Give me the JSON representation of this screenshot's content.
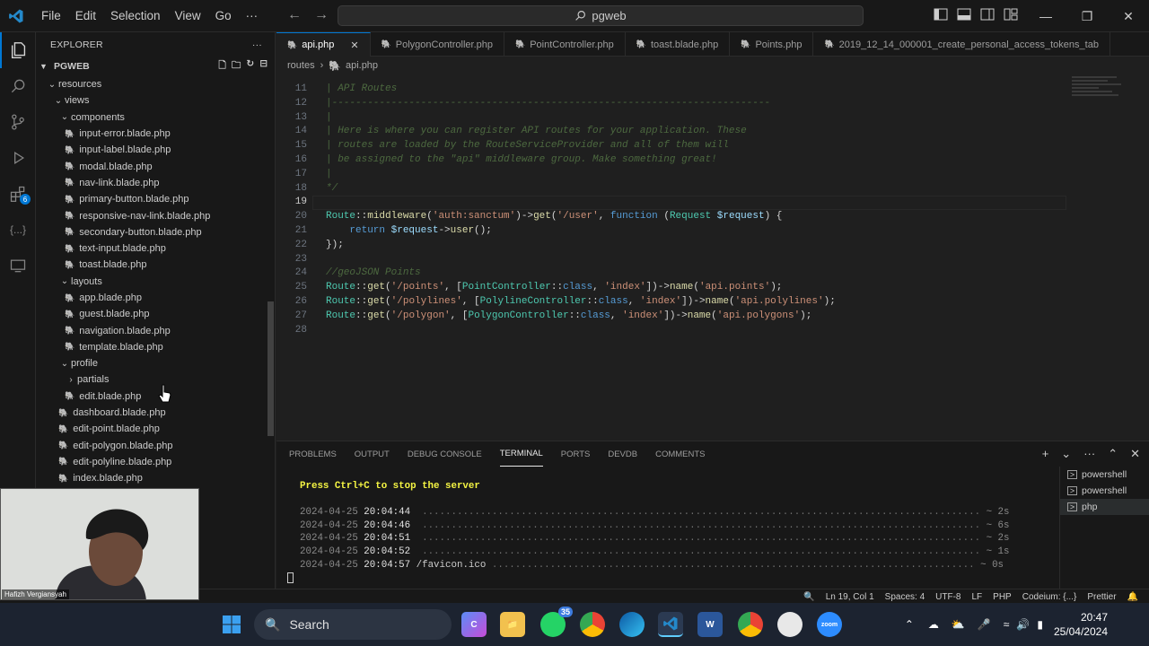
{
  "titlebar": {
    "menu": [
      "File",
      "Edit",
      "Selection",
      "View",
      "Go",
      "···"
    ],
    "search": "pgweb"
  },
  "explorer": {
    "header": "EXPLORER",
    "root": "PGWEB",
    "tree": [
      {
        "label": "resources",
        "type": "folder",
        "indent": 1,
        "open": true
      },
      {
        "label": "views",
        "type": "folder",
        "indent": 2,
        "open": true
      },
      {
        "label": "components",
        "type": "folder",
        "indent": 3,
        "open": true
      },
      {
        "label": "input-error.blade.php",
        "type": "file",
        "indent": 4
      },
      {
        "label": "input-label.blade.php",
        "type": "file",
        "indent": 4
      },
      {
        "label": "modal.blade.php",
        "type": "file",
        "indent": 4
      },
      {
        "label": "nav-link.blade.php",
        "type": "file",
        "indent": 4
      },
      {
        "label": "primary-button.blade.php",
        "type": "file",
        "indent": 4
      },
      {
        "label": "responsive-nav-link.blade.php",
        "type": "file",
        "indent": 4
      },
      {
        "label": "secondary-button.blade.php",
        "type": "file",
        "indent": 4
      },
      {
        "label": "text-input.blade.php",
        "type": "file",
        "indent": 4
      },
      {
        "label": "toast.blade.php",
        "type": "file",
        "indent": 4
      },
      {
        "label": "layouts",
        "type": "folder",
        "indent": 3,
        "open": true
      },
      {
        "label": "app.blade.php",
        "type": "file",
        "indent": 4
      },
      {
        "label": "guest.blade.php",
        "type": "file",
        "indent": 4
      },
      {
        "label": "navigation.blade.php",
        "type": "file",
        "indent": 4
      },
      {
        "label": "template.blade.php",
        "type": "file",
        "indent": 4
      },
      {
        "label": "profile",
        "type": "folder",
        "indent": 3,
        "open": true
      },
      {
        "label": "partials",
        "type": "folder",
        "indent": 4,
        "open": false
      },
      {
        "label": "edit.blade.php",
        "type": "file",
        "indent": 4
      },
      {
        "label": "dashboard.blade.php",
        "type": "file",
        "indent": 3
      },
      {
        "label": "edit-point.blade.php",
        "type": "file",
        "indent": 3
      },
      {
        "label": "edit-polygon.blade.php",
        "type": "file",
        "indent": 3
      },
      {
        "label": "edit-polyline.blade.php",
        "type": "file",
        "indent": 3
      },
      {
        "label": "index.blade.php",
        "type": "file",
        "indent": 3
      }
    ]
  },
  "tabs": [
    "api.php",
    "PolygonController.php",
    "PointController.php",
    "toast.blade.php",
    "Points.php",
    "2019_12_14_000001_create_personal_access_tokens_tab"
  ],
  "breadcrumb": [
    "routes",
    "api.php"
  ],
  "editor": {
    "lines": [
      {
        "n": "11",
        "code": "| API Routes",
        "c": "comment"
      },
      {
        "n": "12",
        "code": "|--------------------------------------------------------------------------",
        "c": "comment"
      },
      {
        "n": "13",
        "code": "|",
        "c": "comment"
      },
      {
        "n": "14",
        "code": "| Here is where you can register API routes for your application. These",
        "c": "comment"
      },
      {
        "n": "15",
        "code": "| routes are loaded by the RouteServiceProvider and all of them will",
        "c": "comment"
      },
      {
        "n": "16",
        "code": "| be assigned to the \"api\" middleware group. Make something great!",
        "c": "comment"
      },
      {
        "n": "17",
        "code": "|",
        "c": "comment"
      },
      {
        "n": "18",
        "code": "*/",
        "c": "comment"
      },
      {
        "n": "19",
        "code": "",
        "c": "plain"
      },
      {
        "n": "20",
        "code": "Route::middleware('auth:sanctum')->get('/user', function (Request $request) {",
        "c": "plain"
      },
      {
        "n": "21",
        "code": "    return $request->user();",
        "c": "plain"
      },
      {
        "n": "22",
        "code": "});",
        "c": "plain"
      },
      {
        "n": "23",
        "code": "",
        "c": "plain"
      },
      {
        "n": "24",
        "code": "//geoJSON Points",
        "c": "comment"
      },
      {
        "n": "25",
        "code": "Route::get('/points', [PointController::class, 'index'])->name('api.points');",
        "c": "plain"
      },
      {
        "n": "26",
        "code": "Route::get('/polylines', [PolylineController::class, 'index'])->name('api.polylines');",
        "c": "plain"
      },
      {
        "n": "27",
        "code": "Route::get('/polygon', [PolygonController::class, 'index'])->name('api.polygons');",
        "c": "plain"
      },
      {
        "n": "28",
        "code": "",
        "c": "plain"
      }
    ]
  },
  "panel": {
    "tabs": [
      "PROBLEMS",
      "OUTPUT",
      "DEBUG CONSOLE",
      "TERMINAL",
      "PORTS",
      "DEVDB",
      "COMMENTS"
    ],
    "active_tab": "TERMINAL",
    "terminal": [
      {
        "date": "",
        "time": "",
        "path": "Press Ctrl+C to stop the server",
        "dur": ""
      },
      {
        "date": "",
        "time": "",
        "path": "",
        "dur": ""
      },
      {
        "date": "2024-04-25",
        "time": "20:04:44",
        "path": "",
        "dur": "~ 2s"
      },
      {
        "date": "2024-04-25",
        "time": "20:04:46",
        "path": "",
        "dur": "~ 6s"
      },
      {
        "date": "2024-04-25",
        "time": "20:04:51",
        "path": "",
        "dur": "~ 2s"
      },
      {
        "date": "2024-04-25",
        "time": "20:04:52",
        "path": "",
        "dur": "~ 1s"
      },
      {
        "date": "2024-04-25",
        "time": "20:04:57",
        "path": "/favicon.ico",
        "dur": "~ 0s"
      }
    ],
    "shells": [
      "powershell",
      "powershell",
      "php"
    ]
  },
  "statusbar": {
    "position": "Ln 19, Col 1",
    "spaces": "Spaces: 4",
    "encoding": "UTF-8",
    "eol": "LF",
    "language": "PHP",
    "codeium": "Codeium: {...}",
    "prettier": "Prettier"
  },
  "webcam": {
    "name": "Hafizh Vergiansyah"
  },
  "taskbar": {
    "search": "Search",
    "whatsapp_badge": "35",
    "time": "20:47",
    "date": "25/04/2024"
  }
}
